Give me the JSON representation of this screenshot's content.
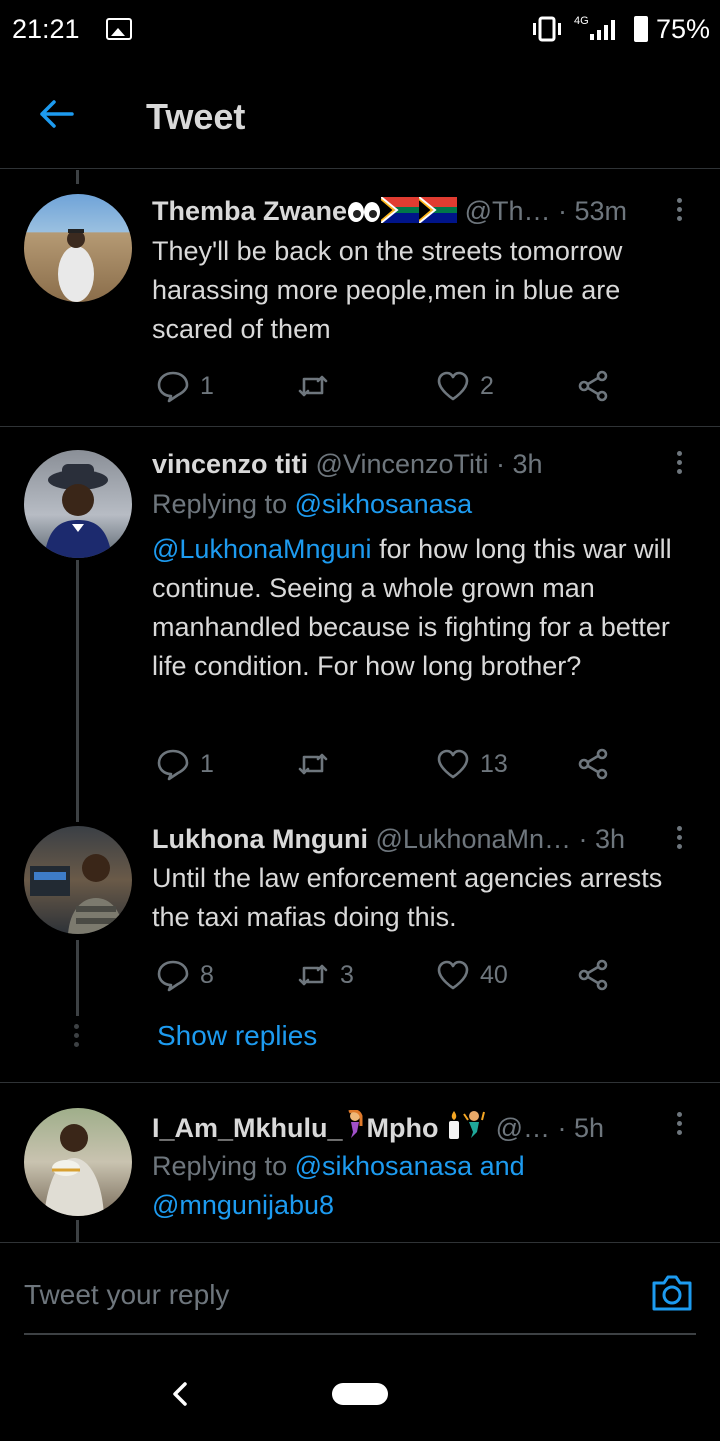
{
  "status_bar": {
    "time": "21:21",
    "network": "4G",
    "battery": "75%"
  },
  "header": {
    "title": "Tweet"
  },
  "tweets": [
    {
      "name": "Themba Zwane",
      "handle": "@Th…",
      "time": "· 53m",
      "text": "They'll be back on the streets tomorrow harassing more people,men in blue are scared of them",
      "replies": "1",
      "retweets": "",
      "likes": "2"
    },
    {
      "name": "vincenzo titi",
      "handle": "@VincenzoTiti",
      "time": "· 3h",
      "replying_prefix": "Replying to",
      "replying_to": "@sikhosanasa",
      "mention": "@LukhonaMnguni",
      "text": " for how long this war will continue. Seeing a whole grown man manhandled because is fighting for a better life condition. For how long brother?",
      "replies": "1",
      "retweets": "",
      "likes": "13"
    },
    {
      "name": "Lukhona Mnguni",
      "handle": "@LukhonaMn…",
      "time": "· 3h",
      "text": "Until the law enforcement agencies arrests the taxi mafias doing this.",
      "replies": "8",
      "retweets": "3",
      "likes": "40"
    },
    {
      "name_part1": "I_Am_Mkhulu_",
      "name_part2": "Mpho",
      "handle": "@…",
      "time": "· 5h",
      "replying_prefix": "Replying to",
      "replying_to": "@sikhosanasa and",
      "replying_to2": "@mngunijabu8"
    }
  ],
  "show_replies": "Show replies",
  "reply_box": {
    "placeholder": "Tweet your reply"
  }
}
